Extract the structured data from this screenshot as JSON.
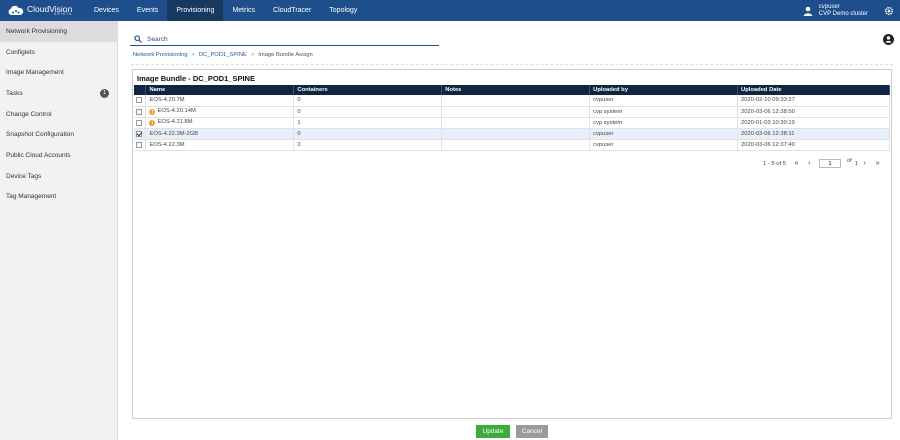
{
  "header": {
    "logo_name": "CloudVision",
    "logo_sub": "ARISTA",
    "nav": [
      "Devices",
      "Events",
      "Provisioning",
      "Metrics",
      "CloudTracer",
      "Topology"
    ],
    "active_nav": "Provisioning",
    "user_name": "cvpuser",
    "cluster": "CVP Demo cluster"
  },
  "sidebar": {
    "items": [
      {
        "label": "Network Provisioning",
        "active": true
      },
      {
        "label": "Configlets"
      },
      {
        "label": "Image Management"
      },
      {
        "label": "Tasks",
        "badge": "1"
      },
      {
        "label": "Change Control"
      },
      {
        "label": "Snapshot Configuration"
      },
      {
        "label": "Public Cloud Accounts"
      },
      {
        "label": "Device Tags"
      },
      {
        "label": "Tag Management"
      }
    ]
  },
  "search": {
    "placeholder": "Search"
  },
  "breadcrumb": {
    "links": [
      "Network Provisioning",
      "DC_POD1_SPINE"
    ],
    "current": "Image Bundle Assign"
  },
  "panel": {
    "title": "Image Bundle - DC_POD1_SPINE",
    "columns": [
      "Name",
      "Containers",
      "Notes",
      "Uploaded by",
      "Uploaded Date"
    ],
    "rows": [
      {
        "name": "EOS-4.20.7M",
        "containers": "0",
        "notes": "",
        "uploaded_by": "cvpuser",
        "date": "2020-02-10 09:33:27",
        "warn": false,
        "checked": false
      },
      {
        "name": "EOS-4.20.14M",
        "containers": "0",
        "notes": "",
        "uploaded_by": "cvp system",
        "date": "2020-03-06 12:38:50",
        "warn": true,
        "checked": false
      },
      {
        "name": "EOS-4.21.8M",
        "containers": "1",
        "notes": "",
        "uploaded_by": "cvp system",
        "date": "2020-01-03 10:30:19",
        "warn": true,
        "checked": false
      },
      {
        "name": "EOS-4.22.3M-2GB",
        "containers": "0",
        "notes": "",
        "uploaded_by": "cvpuser",
        "date": "2020-03-06 12:38:11",
        "warn": false,
        "checked": true
      },
      {
        "name": "EOS-4.22.3M",
        "containers": "2",
        "notes": "",
        "uploaded_by": "cvpuser",
        "date": "2020-03-06 12:37:40",
        "warn": false,
        "checked": false
      }
    ]
  },
  "pager": {
    "range": "1 - 5",
    "of_label": "of",
    "total": "5",
    "page": "1",
    "page_of": "of",
    "pages": "1"
  },
  "buttons": {
    "update": "Update",
    "cancel": "Cancel"
  },
  "colors": {
    "nav_bg": "#1f4e8c",
    "update": "#3cab3c",
    "cancel": "#9a9a9a",
    "warn": "#f0a030"
  }
}
